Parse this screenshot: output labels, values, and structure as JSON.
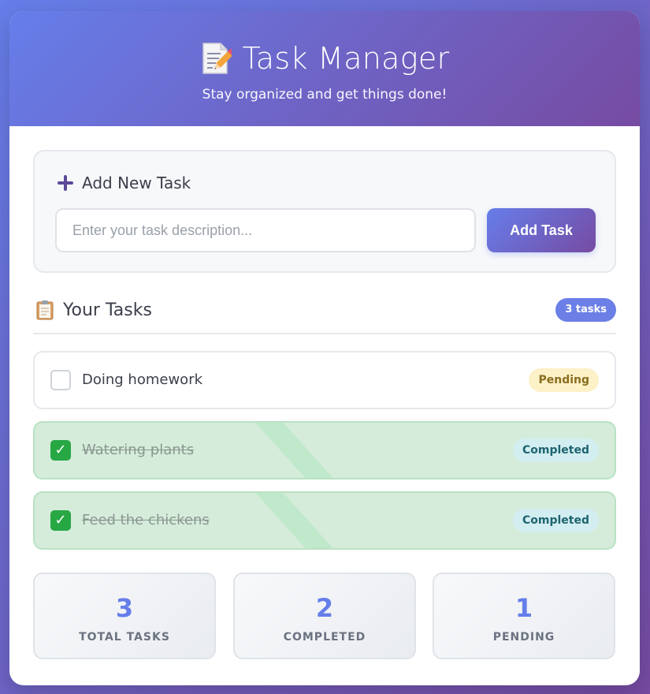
{
  "header": {
    "title": "Task Manager",
    "subtitle": "Stay organized and get things done!",
    "icon": "memo-icon"
  },
  "add_task": {
    "heading": "Add New Task",
    "heading_icon": "plus-icon",
    "input_placeholder": "Enter your task description...",
    "input_value": "",
    "button_label": "Add Task"
  },
  "task_list": {
    "heading": "Your Tasks",
    "heading_icon": "clipboard-icon",
    "count_badge": "3 tasks",
    "items": [
      {
        "text": "Doing homework",
        "status": "Pending",
        "completed": false
      },
      {
        "text": "Watering plants",
        "status": "Completed",
        "completed": true
      },
      {
        "text": "Feed the chickens",
        "status": "Completed",
        "completed": true
      }
    ]
  },
  "stats": [
    {
      "value": "3",
      "label": "TOTAL TASKS"
    },
    {
      "value": "2",
      "label": "COMPLETED"
    },
    {
      "value": "1",
      "label": "PENDING"
    }
  ],
  "colors": {
    "accent_start": "#667eea",
    "accent_end": "#764ba2",
    "completed_bg": "#d5ecdb",
    "check_green": "#28a745",
    "pending_badge": "#fdf1c8",
    "completed_badge": "#d3eef1"
  }
}
